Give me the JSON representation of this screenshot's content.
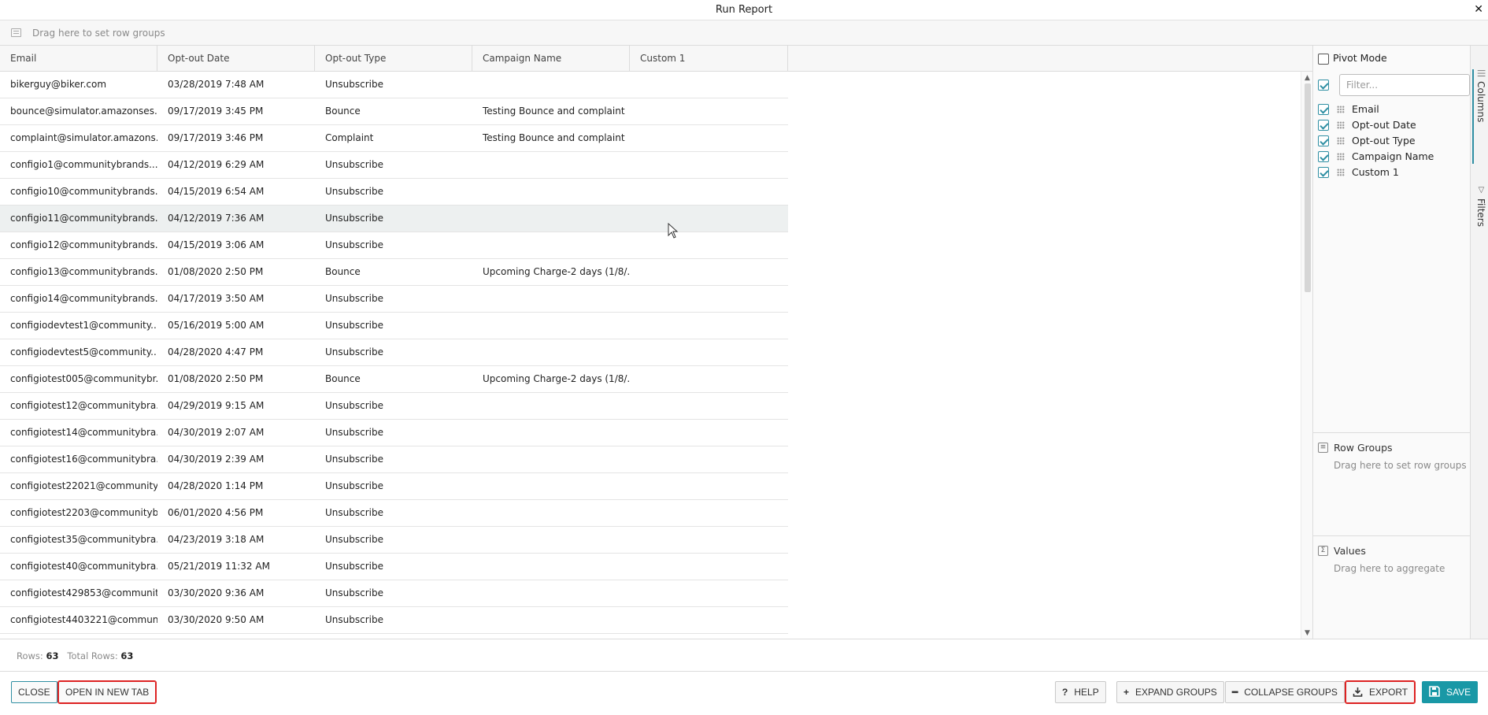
{
  "window": {
    "title": "Run Report",
    "close_glyph": "✕"
  },
  "groupbar": {
    "placeholder": "Drag here to set row groups"
  },
  "grid": {
    "columns": [
      "Email",
      "Opt-out Date",
      "Opt-out Type",
      "Campaign Name",
      "Custom 1"
    ],
    "rows": [
      [
        "bikerguy@biker.com",
        "03/28/2019 7:48 AM",
        "Unsubscribe",
        "",
        ""
      ],
      [
        "bounce@simulator.amazonses....",
        "09/17/2019 3:45 PM",
        "Bounce",
        "Testing Bounce and complaint",
        ""
      ],
      [
        "complaint@simulator.amazons...",
        "09/17/2019 3:46 PM",
        "Complaint",
        "Testing Bounce and complaint",
        ""
      ],
      [
        "configio1@communitybrands....",
        "04/12/2019 6:29 AM",
        "Unsubscribe",
        "",
        ""
      ],
      [
        "configio10@communitybrands...",
        "04/15/2019 6:54 AM",
        "Unsubscribe",
        "",
        ""
      ],
      [
        "configio11@communitybrands...",
        "04/12/2019 7:36 AM",
        "Unsubscribe",
        "",
        ""
      ],
      [
        "configio12@communitybrands...",
        "04/15/2019 3:06 AM",
        "Unsubscribe",
        "",
        ""
      ],
      [
        "configio13@communitybrands...",
        "01/08/2020 2:50 PM",
        "Bounce",
        "Upcoming Charge-2 days (1/8/...",
        ""
      ],
      [
        "configio14@communitybrands...",
        "04/17/2019 3:50 AM",
        "Unsubscribe",
        "",
        ""
      ],
      [
        "configiodevtest1@community...",
        "05/16/2019 5:00 AM",
        "Unsubscribe",
        "",
        ""
      ],
      [
        "configiodevtest5@community...",
        "04/28/2020 4:47 PM",
        "Unsubscribe",
        "",
        ""
      ],
      [
        "configiotest005@communitybr...",
        "01/08/2020 2:50 PM",
        "Bounce",
        "Upcoming Charge-2 days (1/8/...",
        ""
      ],
      [
        "configiotest12@communitybra...",
        "04/29/2019 9:15 AM",
        "Unsubscribe",
        "",
        ""
      ],
      [
        "configiotest14@communitybra...",
        "04/30/2019 2:07 AM",
        "Unsubscribe",
        "",
        ""
      ],
      [
        "configiotest16@communitybra...",
        "04/30/2019 2:39 AM",
        "Unsubscribe",
        "",
        ""
      ],
      [
        "configiotest22021@community...",
        "04/28/2020 1:14 PM",
        "Unsubscribe",
        "",
        ""
      ],
      [
        "configiotest2203@communityb...",
        "06/01/2020 4:56 PM",
        "Unsubscribe",
        "",
        ""
      ],
      [
        "configiotest35@communitybra...",
        "04/23/2019 3:18 AM",
        "Unsubscribe",
        "",
        ""
      ],
      [
        "configiotest40@communitybra...",
        "05/21/2019 11:32 AM",
        "Unsubscribe",
        "",
        ""
      ],
      [
        "configiotest429853@communit...",
        "03/30/2020 9:36 AM",
        "Unsubscribe",
        "",
        ""
      ],
      [
        "configiotest4403221@commun...",
        "03/30/2020 9:50 AM",
        "Unsubscribe",
        "",
        ""
      ]
    ],
    "hover_row_index": 5
  },
  "sidepanel": {
    "pivot_mode_label": "Pivot Mode",
    "filter_placeholder": "Filter...",
    "columns": [
      {
        "label": "Email",
        "checked": true
      },
      {
        "label": "Opt-out Date",
        "checked": true
      },
      {
        "label": "Opt-out Type",
        "checked": true
      },
      {
        "label": "Campaign Name",
        "checked": true
      },
      {
        "label": "Custom 1",
        "checked": true
      }
    ],
    "row_groups": {
      "title": "Row Groups",
      "hint": "Drag here to set row groups"
    },
    "values": {
      "title": "Values",
      "hint": "Drag here to aggregate"
    }
  },
  "sidetabs": {
    "columns": "Columns",
    "filters": "Filters"
  },
  "status": {
    "rows_label": "Rows:",
    "rows_value": "63",
    "total_label": "Total Rows:",
    "total_value": "63"
  },
  "footer": {
    "close": "CLOSE",
    "open_new_tab": "OPEN IN NEW TAB",
    "help": "HELP",
    "expand_groups": "EXPAND GROUPS",
    "collapse_groups": "COLLAPSE GROUPS",
    "export": "EXPORT",
    "save": "SAVE"
  },
  "colors": {
    "accent": "#1998a6",
    "highlight_box": "#dd2222",
    "header_bg": "#f7f7f7",
    "hover_row": "#edf0f0"
  }
}
